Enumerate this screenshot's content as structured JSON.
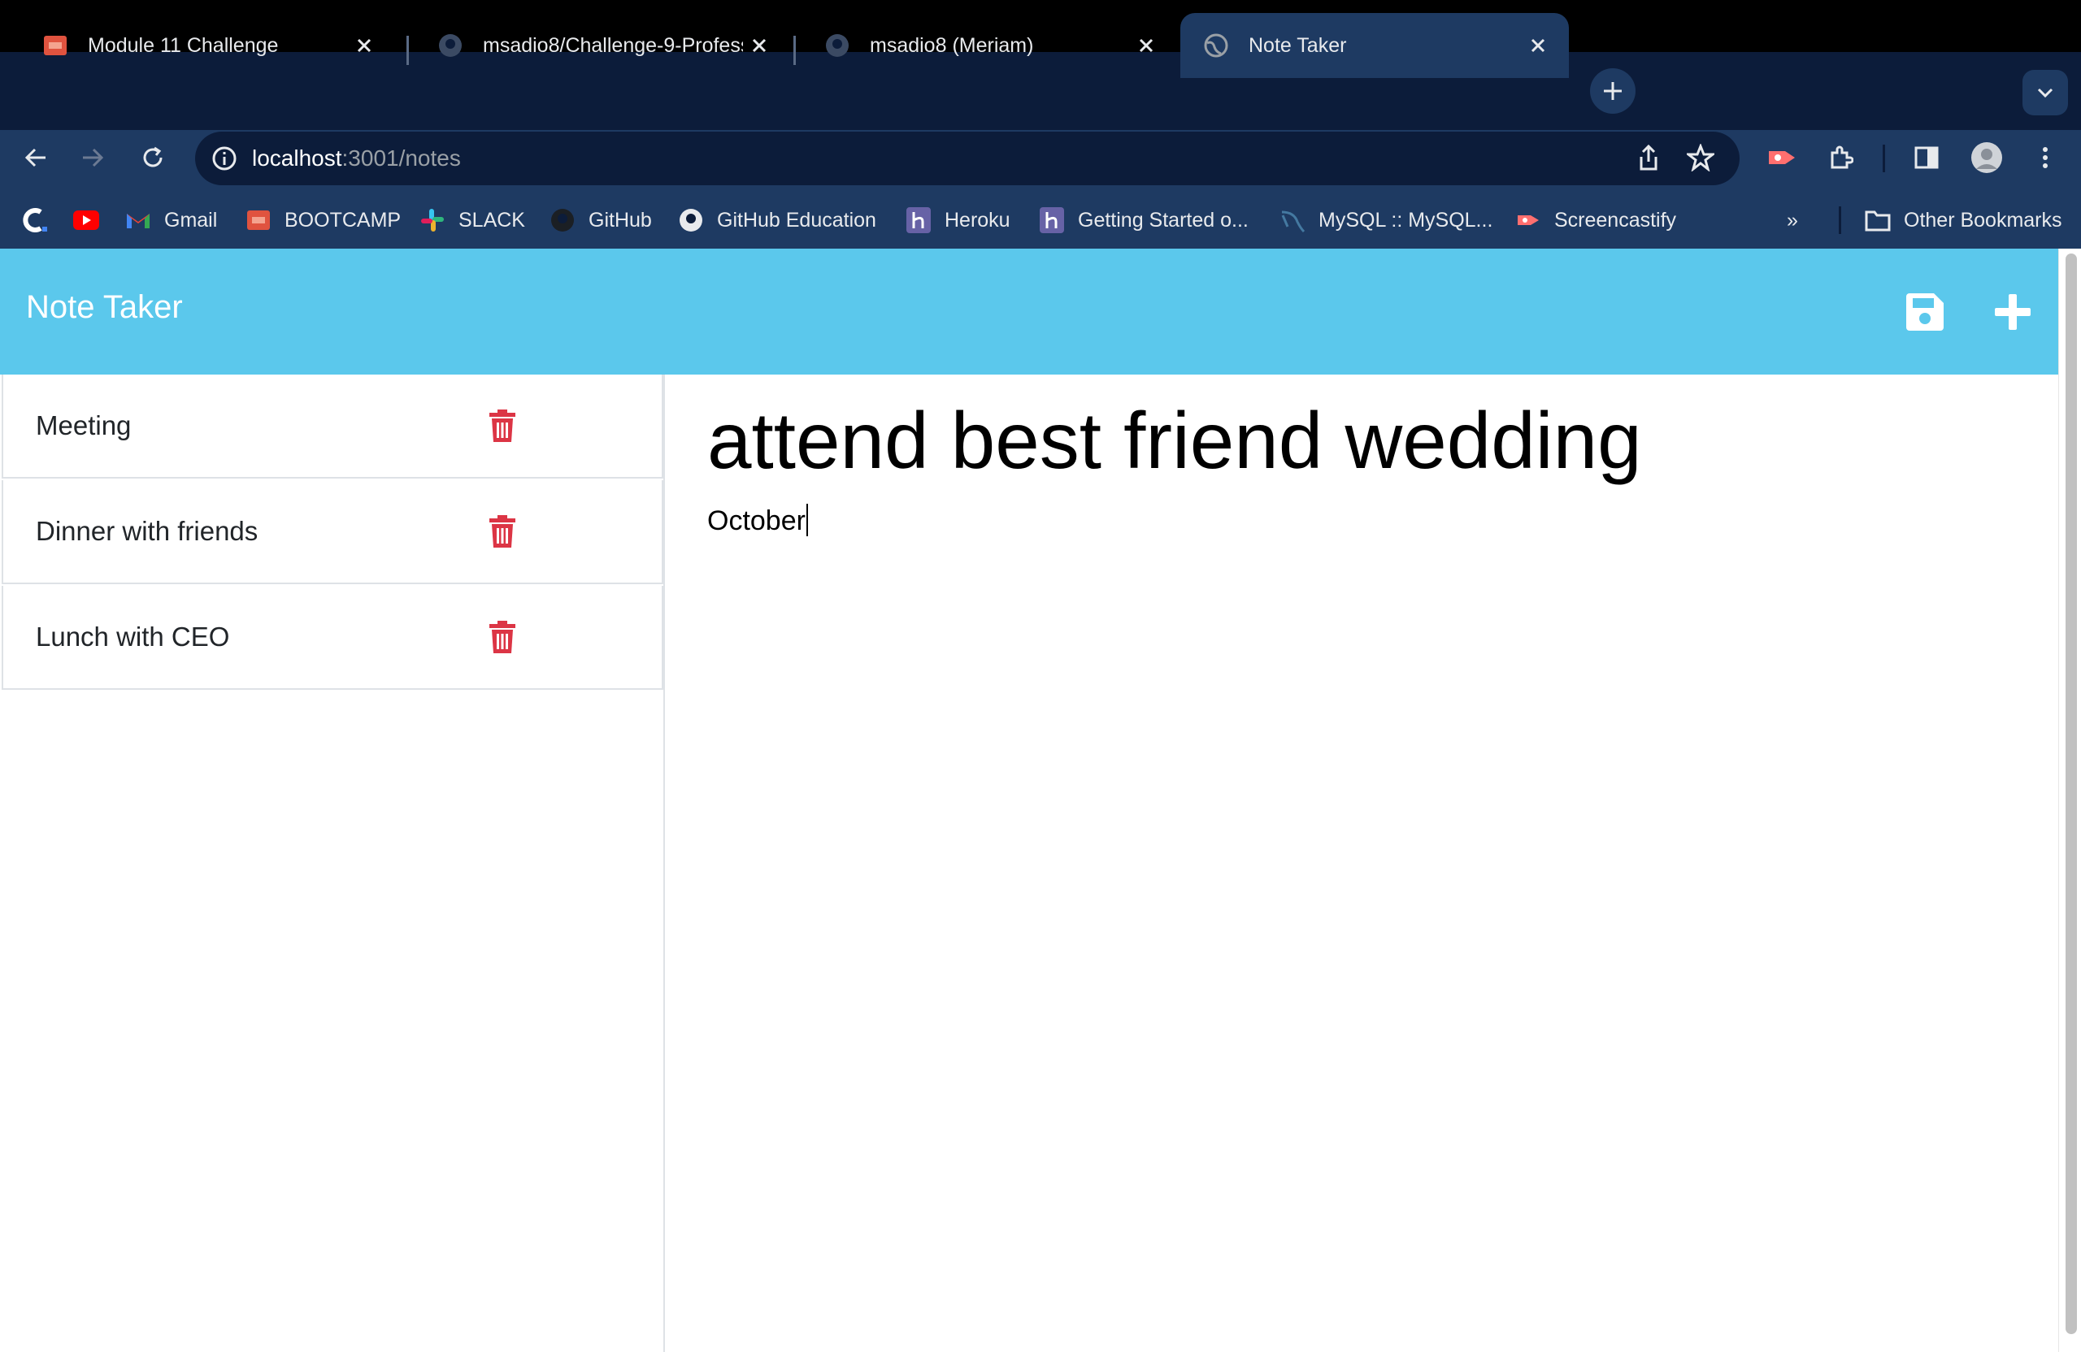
{
  "browser": {
    "tabs": [
      {
        "title": "Module 11 Challenge",
        "icon": "bootcamp-icon",
        "active": false
      },
      {
        "title": "msadio8/Challenge-9-Professi",
        "icon": "github-icon",
        "active": false
      },
      {
        "title": "msadio8 (Meriam)",
        "icon": "github-icon",
        "active": false
      },
      {
        "title": "Note Taker",
        "icon": "globe-icon",
        "active": true
      }
    ],
    "address": {
      "host": "localhost",
      "rest": ":3001/notes"
    },
    "bookmarks": [
      {
        "label": "",
        "icon": "c-icon"
      },
      {
        "label": "",
        "icon": "youtube-icon"
      },
      {
        "label": "Gmail",
        "icon": "gmail-icon"
      },
      {
        "label": "BOOTCAMP",
        "icon": "bootcamp-icon"
      },
      {
        "label": "SLACK",
        "icon": "slack-icon"
      },
      {
        "label": "GitHub",
        "icon": "github-icon"
      },
      {
        "label": "GitHub Education",
        "icon": "github-icon"
      },
      {
        "label": "Heroku",
        "icon": "heroku-icon"
      },
      {
        "label": "Getting Started o...",
        "icon": "heroku-icon"
      },
      {
        "label": "MySQL :: MySQL...",
        "icon": "mysql-icon"
      },
      {
        "label": "Screencastify",
        "icon": "screencastify-icon"
      }
    ],
    "overflow": "»",
    "other_bookmarks": "Other Bookmarks"
  },
  "app": {
    "brand": "Note Taker",
    "colors": {
      "navbar": "#5bc8ec",
      "trash": "#dc3545"
    }
  },
  "notes": [
    {
      "title": "Meeting"
    },
    {
      "title": "Dinner with friends"
    },
    {
      "title": "Lunch with CEO"
    }
  ],
  "active_note": {
    "title": "attend best friend wedding",
    "text": "October"
  }
}
